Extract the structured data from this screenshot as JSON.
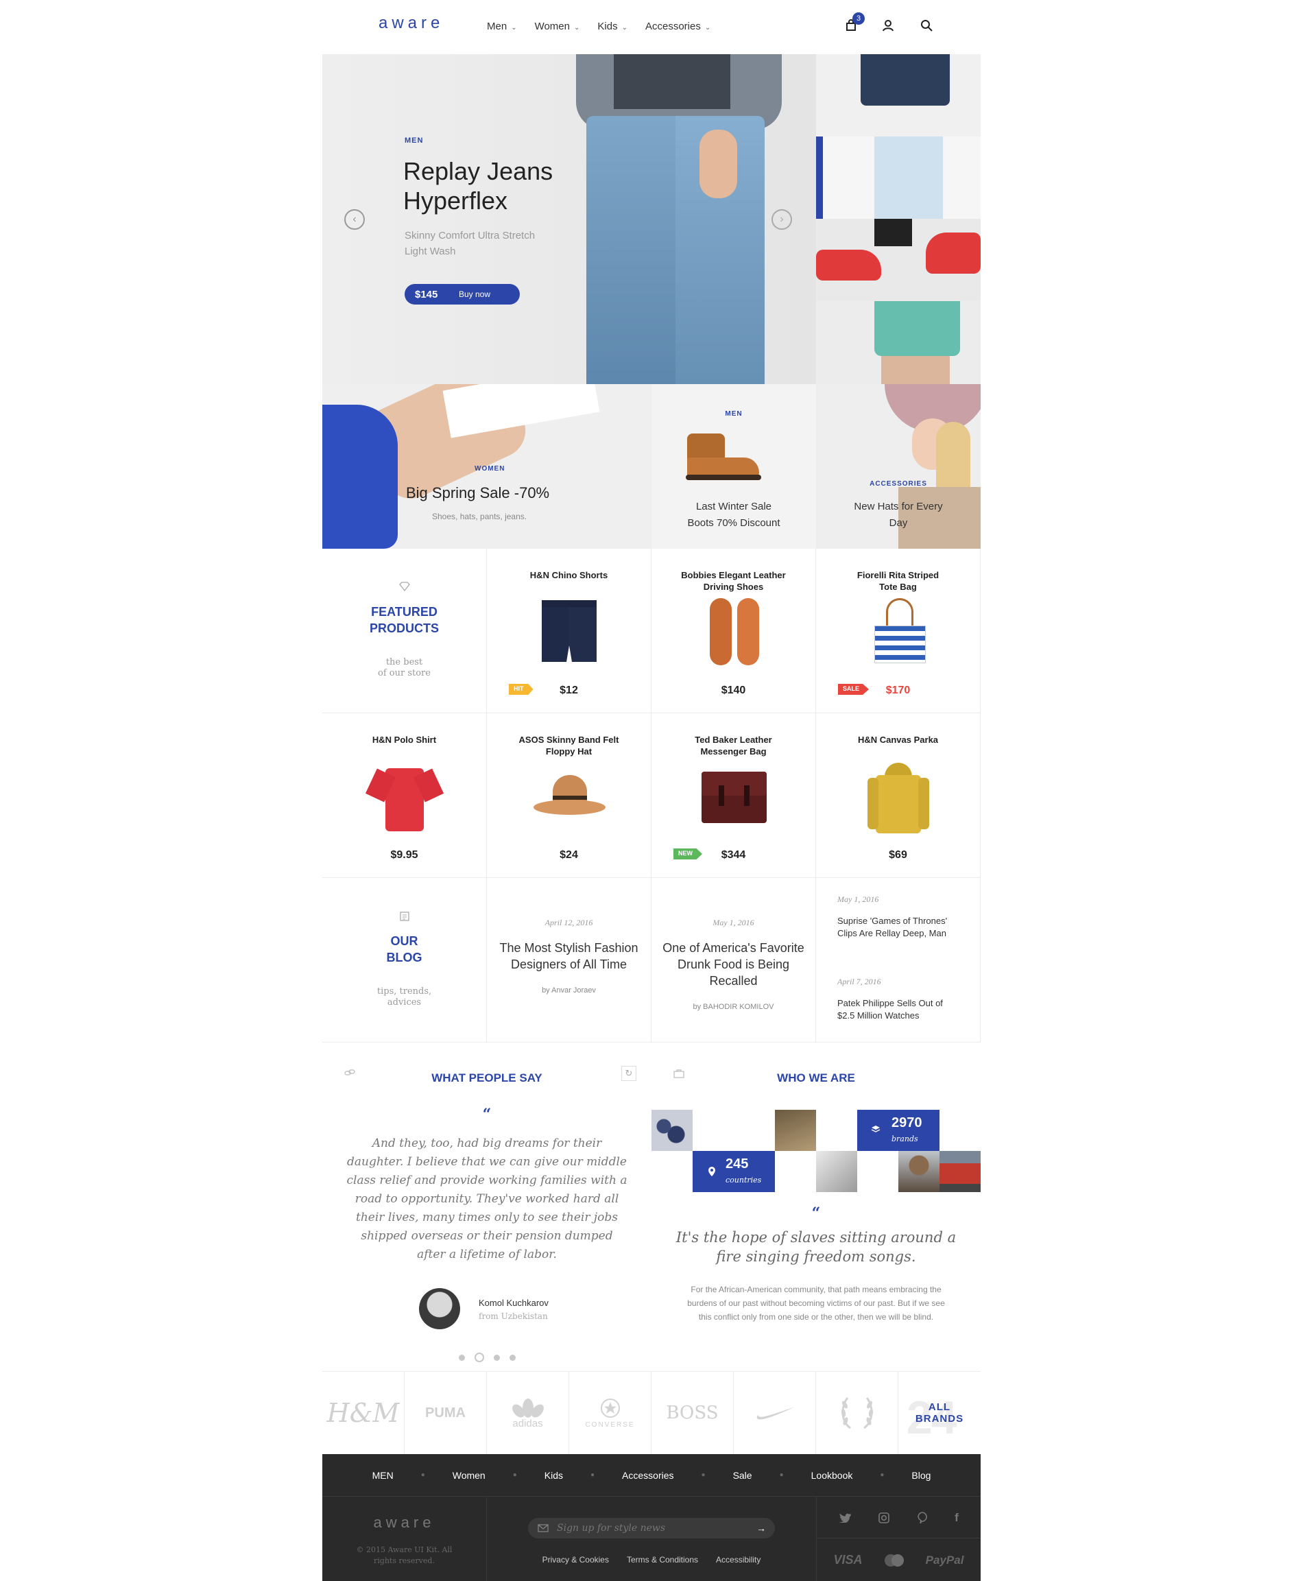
{
  "header": {
    "logo": "aware",
    "nav": [
      {
        "label": "Men"
      },
      {
        "label": "Women"
      },
      {
        "label": "Kids"
      },
      {
        "label": "Accessories"
      }
    ],
    "cart_count": "3"
  },
  "hero": {
    "category": "MEN",
    "title_line1": "Replay Jeans",
    "title_line2": "Hyperflex",
    "subtitle_line1": "Skinny Comfort Ultra Stretch",
    "subtitle_line2": "Light Wash",
    "price": "$145",
    "cta": "Buy now"
  },
  "promos": [
    {
      "category": "WOMEN",
      "title": "Big Spring Sale -70%",
      "subtitle": "Shoes, hats, pants, jeans."
    },
    {
      "category": "MEN",
      "title_line1": "Last Winter Sale",
      "title_line2": "Boots 70% Discount"
    },
    {
      "category": "ACCESSORIES",
      "title_line1": "New Hats for Every",
      "title_line2": "Day"
    }
  ],
  "featured": {
    "title_line1": "FEATURED",
    "title_line2": "PRODUCTS",
    "sub_line1": "the best",
    "sub_line2": "of our store"
  },
  "products": [
    {
      "name_line1": "H&N Chino Shorts",
      "name_line2": "",
      "price": "$12",
      "tag": "HIT"
    },
    {
      "name_line1": "Bobbies Elegant Leather",
      "name_line2": "Driving Shoes",
      "price": "$140",
      "tag": ""
    },
    {
      "name_line1": "Fiorelli Rita Striped",
      "name_line2": "Tote Bag",
      "price": "$170",
      "tag": "SALE"
    },
    {
      "name_line1": "H&N Polo Shirt",
      "name_line2": "",
      "price": "$9.95",
      "tag": ""
    },
    {
      "name_line1": "ASOS Skinny Band Felt",
      "name_line2": "Floppy Hat",
      "price": "$24",
      "tag": ""
    },
    {
      "name_line1": "Ted Baker Leather",
      "name_line2": "Messenger Bag",
      "price": "$344",
      "tag": "NEW"
    },
    {
      "name_line1": "H&N Canvas Parka",
      "name_line2": "",
      "price": "$69",
      "tag": ""
    }
  ],
  "blog": {
    "title_line1": "OUR",
    "title_line2": "BLOG",
    "sub_line1": "tips, trends,",
    "sub_line2": "advices",
    "posts": [
      {
        "date": "April 12, 2016",
        "line1": "The Most Stylish Fashion",
        "line2": "Designers of All Time",
        "line3": "",
        "by": "by Anvar Joraev"
      },
      {
        "date": "May 1, 2016",
        "line1": "One of America's Favorite",
        "line2": "Drunk Food is Being",
        "line3": "Recalled",
        "by": "by BAHODIR KOMILOV"
      }
    ],
    "side_posts": [
      {
        "date": "May 1, 2016",
        "line1": "Suprise 'Games of Thrones'",
        "line2": "Clips Are Rellay Deep, Man"
      },
      {
        "date": "April 7, 2016",
        "line1": "Patek Philippe Sells Out of",
        "line2": "$2.5 Million Watches"
      }
    ]
  },
  "testimonials": {
    "heading": "WHAT PEOPLE SAY",
    "quote_lines": [
      "And they, too, had big dreams for their",
      "daughter. I believe that we can give our middle",
      "class relief and provide working families with a",
      "road to opportunity. They've worked hard all",
      "their lives, many times only to see their jobs",
      "shipped overseas or their pension dumped",
      "after a lifetime of labor."
    ],
    "author": "Komol Kuchkarov",
    "author_from": "from Uzbekistan"
  },
  "who": {
    "heading": "WHO WE ARE",
    "stat1_value": "2970",
    "stat1_label": "brands",
    "stat2_value": "245",
    "stat2_label": "countries",
    "quote_line1": "It's the hope of slaves sitting around a",
    "quote_line2": "fire singing freedom songs.",
    "body_line1": "For the African-American community, that path means embracing the",
    "body_line2": "burdens of our past without becoming victims of our past. But if we see",
    "body_line3": "this conflict only from one side or the other, then we will be blind."
  },
  "brands": {
    "items": [
      "H&M",
      "PUMA",
      "adidas",
      "CONVERSE",
      "BOSS",
      "nike",
      "laurel"
    ],
    "all_line1": "ALL",
    "all_line2": "BRANDS",
    "all_bg": "24"
  },
  "footer": {
    "nav": [
      "MEN",
      "Women",
      "Kids",
      "Accessories",
      "Sale",
      "Lookbook",
      "Blog"
    ],
    "logo": "aware",
    "copyright_line1": "© 2015 Aware UI Kit. All",
    "copyright_line2": "rights reserved.",
    "signup_placeholder": "Sign up for style news",
    "links": [
      "Privacy & Cookies",
      "Terms & Conditions",
      "Accessibility"
    ],
    "payments": [
      "VISA",
      "PayPal"
    ]
  },
  "colors": {
    "accent": "#2b45a8",
    "footer_bg": "#2a2a2a",
    "tag_hit": "#f7b731",
    "tag_sale": "#e8453c",
    "tag_new": "#5cb85c"
  }
}
